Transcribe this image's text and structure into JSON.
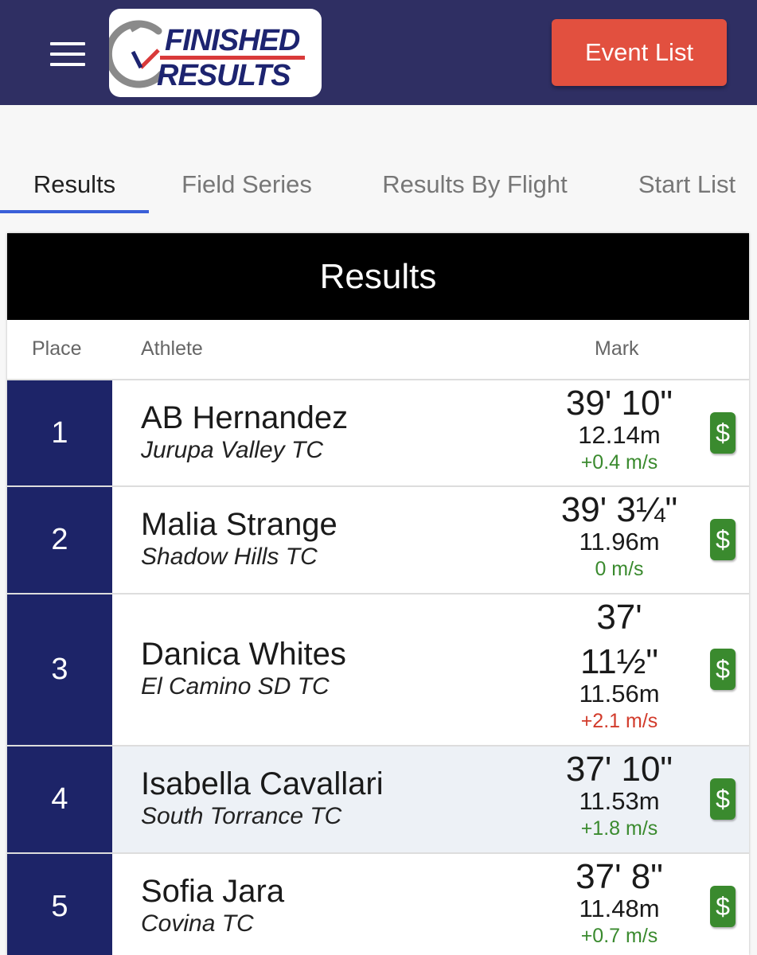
{
  "header": {
    "menu_icon": "hamburger-icon",
    "logo_line1": "FINISHED",
    "logo_line2": "RESULTS",
    "event_list_label": "Event List",
    "colors": {
      "bar": "#2f2f63",
      "button": "#e2503f",
      "logo_navy": "#1d2470",
      "logo_red": "#d93a3a"
    }
  },
  "tabs": [
    {
      "label": "Results",
      "active": true
    },
    {
      "label": "Field Series",
      "active": false
    },
    {
      "label": "Results By Flight",
      "active": false
    },
    {
      "label": "Start List",
      "active": false
    }
  ],
  "results": {
    "title": "Results",
    "columns": {
      "place": "Place",
      "athlete": "Athlete",
      "mark": "Mark"
    },
    "rows": [
      {
        "place": "1",
        "name": "AB Hernandez",
        "team": "Jurupa Valley TC",
        "mark_imperial": "39' 10\"",
        "mark_metric": "12.14m",
        "wind": "+0.4 m/s",
        "wind_color": "green",
        "highlighted": false,
        "action_icon": "dollar-icon"
      },
      {
        "place": "2",
        "name": "Malia Strange",
        "team": "Shadow Hills TC",
        "mark_imperial": "39' 3¼\"",
        "mark_metric": "11.96m",
        "wind": "0 m/s",
        "wind_color": "green",
        "highlighted": false,
        "action_icon": "dollar-icon"
      },
      {
        "place": "3",
        "name": "Danica Whites",
        "team": "El Camino SD TC",
        "mark_imperial_line1": "37'",
        "mark_imperial_line2": "11½\"",
        "mark_metric": "11.56m",
        "wind": "+2.1 m/s",
        "wind_color": "red",
        "highlighted": false,
        "action_icon": "dollar-icon"
      },
      {
        "place": "4",
        "name": "Isabella Cavallari",
        "team": "South Torrance TC",
        "mark_imperial": "37' 10\"",
        "mark_metric": "11.53m",
        "wind": "+1.8 m/s",
        "wind_color": "green",
        "highlighted": true,
        "action_icon": "dollar-icon"
      },
      {
        "place": "5",
        "name": "Sofia Jara",
        "team": "Covina TC",
        "mark_imperial": "37' 8\"",
        "mark_metric": "11.48m",
        "wind": "+0.7 m/s",
        "wind_color": "green",
        "highlighted": false,
        "action_icon": "dollar-icon"
      }
    ],
    "dollar_symbol": "$"
  }
}
